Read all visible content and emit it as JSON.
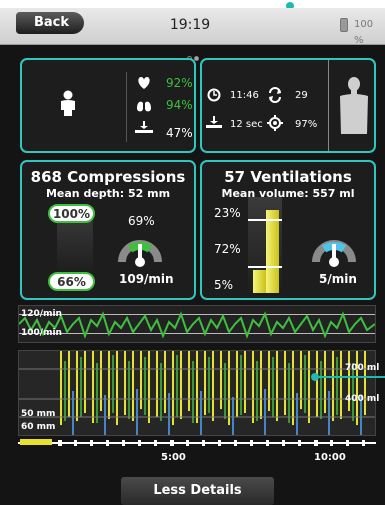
{
  "status_bar": {
    "back_label": "Back",
    "time": "19:19",
    "battery_percent": "100 %"
  },
  "vitals": {
    "heart_value": "92%",
    "lungs_value": "94%",
    "compression_value": "47%"
  },
  "session": {
    "clock_time": "11:46",
    "restarts": "29",
    "pause_time": "12 sec",
    "target_value": "97%"
  },
  "compressions": {
    "title": "868 Compressions",
    "subtitle": "Mean depth: 52 mm",
    "top_pill": "100%",
    "bottom_pill": "66%",
    "gauge_percent": "69%",
    "gauge_level": 0.69,
    "rate": "109/min"
  },
  "ventilations": {
    "title": "57 Ventilations",
    "subtitle": "Mean volume: 557 ml",
    "bar_labels": [
      "23%",
      "72%",
      "5%"
    ],
    "rate": "5/min"
  },
  "rate_strip": {
    "upper_label": "120/min",
    "lower_label": "100/min"
  },
  "waveform": {
    "depth_label_1": "50 mm",
    "depth_label_2": "60 mm",
    "volume_label_1": "700 ml",
    "volume_label_2": "400 ml"
  },
  "timeline": {
    "tick_1": "5:00",
    "tick_2": "10:00"
  },
  "actions": {
    "less_details": "Less Details"
  },
  "colors": {
    "accent": "#2ec8bf",
    "green": "#3fbf3f",
    "yellow": "#e8e22e",
    "blue": "#4aa6ff"
  }
}
